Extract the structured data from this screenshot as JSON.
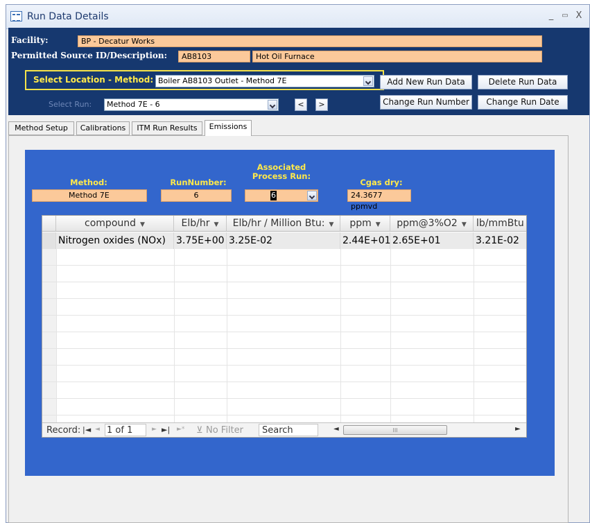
{
  "window": {
    "title": "Run Data Details"
  },
  "header": {
    "facility_label": "Facility:",
    "facility_value": "BP - Decatur Works",
    "source_label": "Permitted Source ID/Description:",
    "source_id": "AB8103",
    "source_desc": "Hot Oil Furnace",
    "location_label": "Select Location - Method:",
    "location_value": "Boiler AB8103 Outlet - Method 7E",
    "run_label": "Select Run:",
    "run_value": "Method 7E - 6",
    "prev_label": "<",
    "next_label": ">",
    "add_run": "Add New Run Data",
    "delete_run": "Delete Run Data",
    "change_number": "Change Run Number",
    "change_date": "Change Run Date"
  },
  "tabs": [
    {
      "label": "Method Setup"
    },
    {
      "label": "Calibrations"
    },
    {
      "label": "ITM Run Results"
    },
    {
      "label": "Emissions",
      "active": true
    }
  ],
  "emissions": {
    "method_label": "Method:",
    "method_value": "Method 7E",
    "runnumber_label": "RunNumber:",
    "runnumber_value": "6",
    "process_label_1": "Associated",
    "process_label_2": "Process Run:",
    "process_value": "6",
    "cgas_label": "Cgas dry:",
    "cgas_value": "24.3677 ppmvd"
  },
  "table": {
    "columns": [
      "compound",
      "Elb/hr",
      "Elb/hr / Million Btu:",
      "ppm",
      "ppm@3%O2",
      "lb/mmBtu"
    ],
    "rows": [
      [
        "Nitrogen oxides (NOx)",
        "3.75E+00",
        "3.25E-02",
        "2.44E+01",
        "2.65E+01",
        "3.21E-02"
      ]
    ]
  },
  "navigation": {
    "record_label": "Record:",
    "record_value": "1 of 1",
    "filter_label": "No Filter",
    "search_label": "Search"
  },
  "colors": {
    "header_bg": "#16386f",
    "panel_bg": "#3366cc",
    "field_bg": "#fbc99a",
    "label_yellow": "#ffe94a"
  }
}
